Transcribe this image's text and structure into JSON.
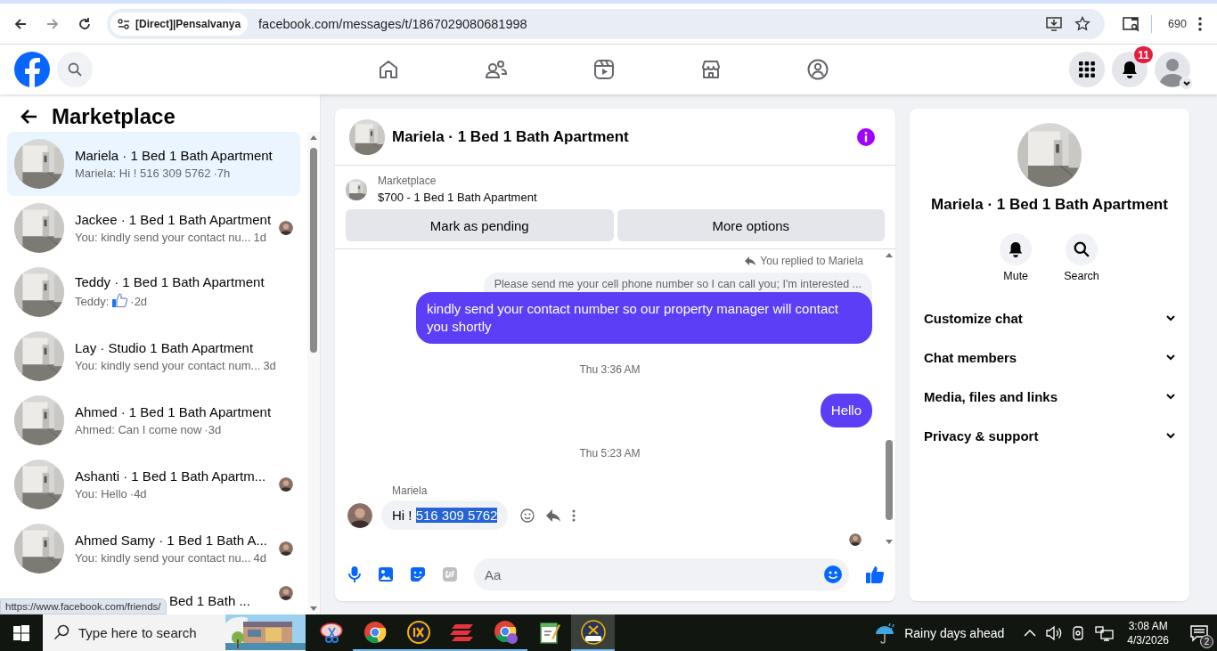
{
  "browser": {
    "site_chip": "[Direct]|Pensalvanya",
    "url": "facebook.com/messages/t/1867029080681998",
    "profile_label": "690"
  },
  "header": {
    "notification_count": "11"
  },
  "sidebar": {
    "title": "Marketplace",
    "conversations": [
      {
        "title": "Mariela · 1 Bed 1 Bath Apartment",
        "preview": "Mariela: Hi ! 516 309 5762",
        "time": "·7h",
        "selected": true,
        "sticker": false,
        "seen_avatar": false
      },
      {
        "title": "Jackee · 1 Bed 1 Bath Apartment",
        "preview": "You: kindly send your contact nu...",
        "time": "1d",
        "selected": false,
        "sticker": false,
        "seen_avatar": true
      },
      {
        "title": "Teddy · 1 Bed 1 Bath Apartment",
        "preview": "Teddy:",
        "time": "·2d",
        "selected": false,
        "sticker": true,
        "seen_avatar": false
      },
      {
        "title": "Lay · Studio 1 Bath Apartment",
        "preview": "You: kindly send your contact num...",
        "time": "3d",
        "selected": false,
        "sticker": false,
        "seen_avatar": false
      },
      {
        "title": "Ahmed · 1 Bed 1 Bath Apartment",
        "preview": "Ahmed: Can I come now",
        "time": "·3d",
        "selected": false,
        "sticker": false,
        "seen_avatar": false
      },
      {
        "title": "Ashanti · 1 Bed 1 Bath Apartm...",
        "preview": "You: Hello",
        "time": "·4d",
        "selected": false,
        "sticker": false,
        "seen_avatar": true
      },
      {
        "title": "Ahmed Samy · 1 Bed 1 Bath A...",
        "preview": "You: kindly send your contact nu...",
        "time": "4d",
        "selected": false,
        "sticker": false,
        "seen_avatar": true
      },
      {
        "title": "Bed 1 Bath ...",
        "selected": false,
        "seen_avatar": true
      }
    ]
  },
  "link_preview": "https://www.facebook.com/friends/",
  "chat": {
    "title": "Mariela · 1 Bed 1 Bath Apartment",
    "listing": {
      "label": "Marketplace",
      "item": "$700 - 1 Bed 1 Bath Apartment"
    },
    "buttons": [
      "Mark as pending",
      "More options"
    ],
    "messages": [
      {
        "kind": "reply_note",
        "text": "You replied to Mariela"
      },
      {
        "kind": "quoted",
        "text": "Please send me your cell phone number so I can call you; I'm interested ..."
      },
      {
        "kind": "outgoing",
        "text": "kindly send your contact number so our property manager will contact you shortly"
      },
      {
        "kind": "timestamp",
        "text": "Thu 3:36 AM"
      },
      {
        "kind": "outgoing",
        "text": "Hello"
      },
      {
        "kind": "timestamp",
        "text": "Thu 5:23 AM"
      },
      {
        "kind": "incoming",
        "sender": "Mariela",
        "text": "Hi !",
        "highlighted": "516 309 5762"
      },
      {
        "kind": "seen"
      }
    ],
    "composer": {
      "placeholder": "Aa"
    }
  },
  "details": {
    "title": "Mariela · 1 Bed 1 Bath Apartment",
    "actions": [
      {
        "kind": "mute",
        "label": "Mute"
      },
      {
        "kind": "search",
        "label": "Search"
      }
    ],
    "sections": [
      {
        "label": "Customize chat",
        "expanded": false
      },
      {
        "label": "Chat members",
        "expanded": false
      },
      {
        "label": "Media, files and links",
        "expanded": false
      },
      {
        "label": "Privacy & support",
        "expanded": false
      }
    ]
  },
  "taskbar": {
    "search_placeholder": "Type here to search",
    "weather": "Rainy days ahead",
    "time": "3:08 AM",
    "date": "4/3/2026",
    "notification_count": "2"
  }
}
